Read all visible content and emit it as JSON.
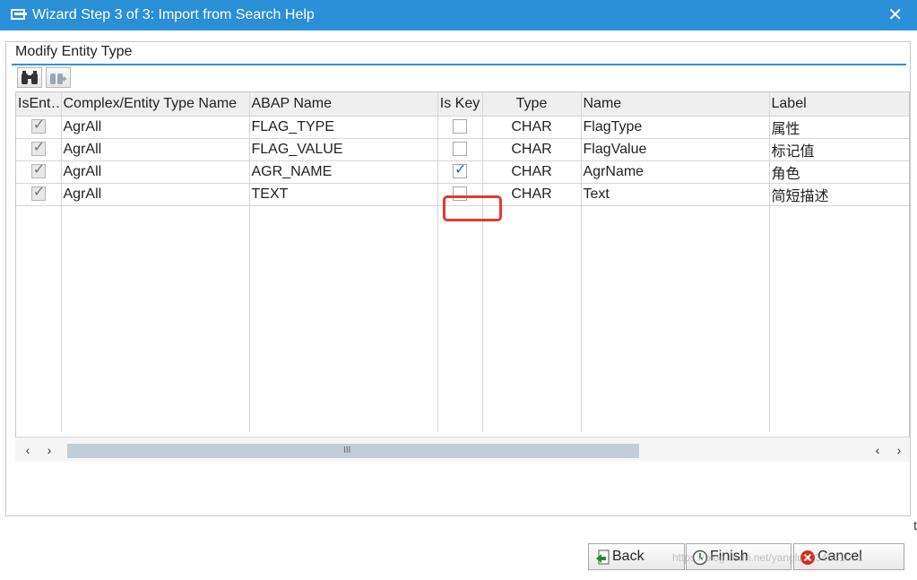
{
  "window": {
    "title": "Wizard Step 3 of 3: Import from Search Help",
    "close_glyph": "✕"
  },
  "group": {
    "title": "Modify Entity Type"
  },
  "toolbar": {
    "icons": [
      "binoculars-icon",
      "find-next-icon"
    ]
  },
  "table": {
    "columns": [
      "IsEnt…",
      "Complex/Entity Type Name",
      "ABAP Name",
      "Is Key",
      "Type",
      "Name",
      "Label"
    ],
    "rows": [
      {
        "is_entity": true,
        "complex": "AgrAll",
        "abap": "FLAG_TYPE",
        "is_key": false,
        "type": "CHAR",
        "name": "FlagType",
        "label": "属性"
      },
      {
        "is_entity": true,
        "complex": "AgrAll",
        "abap": "FLAG_VALUE",
        "is_key": false,
        "type": "CHAR",
        "name": "FlagValue",
        "label": "标记值"
      },
      {
        "is_entity": true,
        "complex": "AgrAll",
        "abap": "AGR_NAME",
        "is_key": true,
        "type": "CHAR",
        "name": "AgrName",
        "label": "角色"
      },
      {
        "is_entity": true,
        "complex": "AgrAll",
        "abap": "TEXT",
        "is_key": false,
        "type": "CHAR",
        "name": "Text",
        "label": "简短描述"
      }
    ]
  },
  "scrollbar": {
    "left_glyphs": [
      "‹",
      "›"
    ],
    "right_glyphs": [
      "‹",
      "›"
    ],
    "grip": "III"
  },
  "buttons": {
    "back": "Back",
    "finish": "Finish",
    "cancel": "Cancel"
  },
  "edge_fragment": "t",
  "watermark": "https://blog.csdn.net/yanglu1234561071",
  "colors": {
    "titlebar": "#2a8fd6",
    "group_line": "#3c90cf",
    "highlight": "#e23a2e",
    "check_blue": "#1a6fc4"
  }
}
